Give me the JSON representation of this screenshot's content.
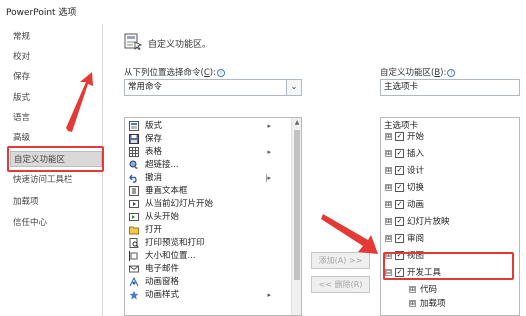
{
  "window": {
    "title": "PowerPoint 选项"
  },
  "nav": {
    "items": [
      {
        "label": "常规"
      },
      {
        "label": "校对"
      },
      {
        "label": "保存"
      },
      {
        "label": "版式"
      },
      {
        "label": "语言"
      },
      {
        "label": "高级"
      },
      {
        "label": "自定义功能区",
        "active": true
      },
      {
        "label": "快速访问工具栏"
      },
      {
        "label": "加载项"
      },
      {
        "label": "信任中心"
      }
    ]
  },
  "header": {
    "title": "自定义功能区。",
    "icon": "ribbon-customize-icon"
  },
  "left": {
    "label_main": "从下列位置选择命令(",
    "label_key": "C",
    "label_end": "):",
    "dropdown_value": "常用命令",
    "commands": [
      {
        "label": "版式",
        "icon": "layout-icon",
        "submenu": "▸"
      },
      {
        "label": "保存",
        "icon": "save-icon",
        "submenu": ""
      },
      {
        "label": "表格",
        "icon": "table-icon",
        "submenu": "▸"
      },
      {
        "label": "超链接...",
        "icon": "hyperlink-icon",
        "submenu": ""
      },
      {
        "label": "撤消",
        "icon": "undo-icon",
        "submenu": "|▸"
      },
      {
        "label": "垂直文本框",
        "icon": "vertical-textbox-icon",
        "submenu": ""
      },
      {
        "label": "从当前幻灯片开始",
        "icon": "play-from-current-icon",
        "submenu": ""
      },
      {
        "label": "从头开始",
        "icon": "play-from-start-icon",
        "submenu": ""
      },
      {
        "label": "打开",
        "icon": "open-folder-icon",
        "submenu": ""
      },
      {
        "label": "打印预览和打印",
        "icon": "print-preview-icon",
        "submenu": ""
      },
      {
        "label": "大小和位置...",
        "icon": "size-position-icon",
        "submenu": ""
      },
      {
        "label": "电子邮件",
        "icon": "email-icon",
        "submenu": ""
      },
      {
        "label": "动画窗格",
        "icon": "animation-pane-icon",
        "submenu": ""
      },
      {
        "label": "动画样式",
        "icon": "animation-style-icon",
        "submenu": "▸"
      }
    ]
  },
  "buttons": {
    "add": "添加(A) >>",
    "remove": "<< 删除(R)"
  },
  "right": {
    "label_main": "自定义功能区(",
    "label_key": "B",
    "label_end": "):",
    "dropdown_value": "主选项卡",
    "tree_header": "主选项卡",
    "tabs": [
      {
        "label": "开始",
        "expander": "⊞",
        "checked": "✓"
      },
      {
        "label": "插入",
        "expander": "⊞",
        "checked": "✓"
      },
      {
        "label": "设计",
        "expander": "⊞",
        "checked": "✓"
      },
      {
        "label": "切换",
        "expander": "⊞",
        "checked": "✓"
      },
      {
        "label": "动画",
        "expander": "⊞",
        "checked": "✓"
      },
      {
        "label": "幻灯片放映",
        "expander": "⊞",
        "checked": "✓"
      },
      {
        "label": "审阅",
        "expander": "⊞",
        "checked": "✓"
      },
      {
        "label": "视图",
        "expander": "⊞",
        "checked": "✓"
      },
      {
        "label": "开发工具",
        "expander": "⊟",
        "checked": "✓"
      }
    ],
    "children": [
      {
        "label": "代码",
        "expander": "⊞"
      },
      {
        "label": "加载项",
        "expander": "⊞"
      }
    ]
  },
  "annotation_color": "#e53935"
}
